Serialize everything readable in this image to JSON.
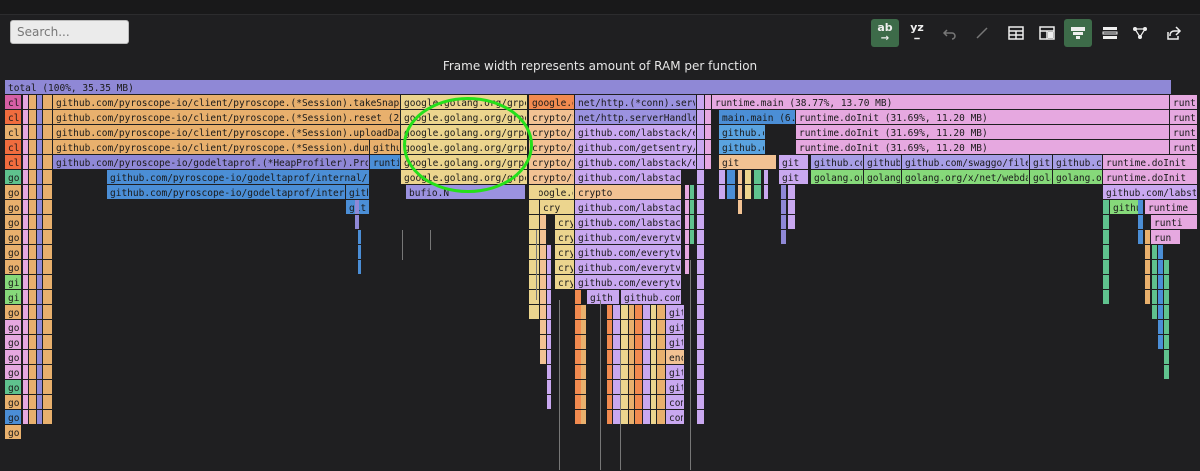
{
  "search": {
    "placeholder": "Search..."
  },
  "toolbar": {
    "abc_label": "ab",
    "xyz_label": "yz",
    "active_color": "#3d6b49"
  },
  "caption": "Frame width represents amount of RAM per function",
  "annotation": {
    "color": "#25e01a",
    "shape": "circle"
  },
  "flamegraph": {
    "rows": [
      [
        {
          "label": "total (100%, 35.35 MB)",
          "color": "#8f88d6"
        }
      ],
      [
        {
          "label": "clo",
          "color": "#d65fa5"
        },
        {
          "label": "github.com/pyroscope-io/client/pyroscope.(*Session).takeSnapshots (29.27",
          "color": "#e8b06d"
        },
        {
          "label": "google.golang.org/grpc.(*a",
          "color": "#ecd58e"
        },
        {
          "label": "google.go",
          "color": "#f18a4f"
        },
        {
          "label": "net/http.(*conn).serve (",
          "color": "#9b92e0"
        },
        {
          "label": "runtime.main (38.77%, 13.70 MB)",
          "color": "#e6a8e0"
        },
        {
          "label": "runt",
          "color": "#e6a8e0"
        }
      ],
      [
        {
          "label": "clo",
          "color": "#f06c3e"
        },
        {
          "label": "github.com/pyroscope-io/client/pyroscope.(*Session).reset (29.27%, 10.",
          "color": "#e8b06d"
        },
        {
          "label": "google.golang.org/grpc.(*a",
          "color": "#ecd58e"
        },
        {
          "label": "crypto/tl",
          "color": "#f2c293"
        },
        {
          "label": "net/http.serverHandler.S",
          "color": "#9b92e0"
        },
        {
          "label": "main.main (6.37",
          "color": "#4b8ed6"
        },
        {
          "label": "runtime.doInit (31.69%, 11.20 MB)",
          "color": "#e6a8e0"
        },
        {
          "label": "runt",
          "color": "#e6a8e0"
        }
      ],
      [
        {
          "label": "clo",
          "color": "#e8b06d"
        },
        {
          "label": "github.com/pyroscope-io/client/pyroscope.(*Session).uploadData (29.27%",
          "color": "#e8b06d"
        },
        {
          "label": "google.golang.org/grpc.(*a",
          "color": "#ecd58e"
        },
        {
          "label": "crypto/tl",
          "color": "#f2c293"
        },
        {
          "label": "github.com/labstack/echo",
          "color": "#c9a8f0"
        },
        {
          "label": "github.c",
          "color": "#5aa3e0"
        },
        {
          "label": "runtime.doInit (31.69%, 11.20 MB)",
          "color": "#e6a8e0"
        },
        {
          "label": "runt",
          "color": "#e6a8e0"
        }
      ],
      [
        {
          "label": "clo",
          "color": "#f06c3e"
        },
        {
          "label": "github.com/pyroscope-io/client/pyroscope.(*Session).dumpHeapProf",
          "color": "#e8b06d"
        },
        {
          "label": "githu",
          "color": "#e8b06d"
        },
        {
          "label": "google.golang.org/grpc/int",
          "color": "#ecd58e"
        },
        {
          "label": "crypto/tl",
          "color": "#f2c293"
        },
        {
          "label": "github.com/getsentry/sen",
          "color": "#c9a8f0"
        },
        {
          "label": "github.c",
          "color": "#5aa3e0"
        },
        {
          "label": "runtime.doInit (31.69%, 11.20 MB)",
          "color": "#e6a8e0"
        },
        {
          "label": "runt",
          "color": "#e6a8e0"
        }
      ],
      [
        {
          "label": "clo",
          "color": "#f06c3e"
        },
        {
          "label": "github.com/pyroscope-io/godeltaprof.(*HeapProfiler).Profile (26.",
          "color": "#8f88d6"
        },
        {
          "label": "runtim",
          "color": "#4b8ed6"
        },
        {
          "label": "google.golang.org/grpc/int",
          "color": "#ecd58e"
        },
        {
          "label": "crypto/tl",
          "color": "#f2c293"
        },
        {
          "label": "github.com/labstack/echo",
          "color": "#c9a8f0"
        },
        {
          "label": "git",
          "color": "#f2c293"
        },
        {
          "label": "git",
          "color": "#c9a8f0"
        },
        {
          "label": "github.com",
          "color": "#a79ee6"
        },
        {
          "label": "github.",
          "color": "#a79ee6"
        },
        {
          "label": "github.com/swaggo/files.in",
          "color": "#a79ee6"
        },
        {
          "label": "gith",
          "color": "#a79ee6"
        },
        {
          "label": "github.com",
          "color": "#a79ee6"
        },
        {
          "label": "runtime.doInit",
          "color": "#e6a8e0"
        }
      ],
      [
        {
          "label": "goo",
          "color": "#5fc28e"
        },
        {
          "label": "github.com/pyroscope-io/godeltaprof/internal/pprof.(*D",
          "color": "#4b8ed6"
        },
        {
          "label": "google.golang.org/grpc/in",
          "color": "#ecd58e"
        },
        {
          "label": "crypto/tl",
          "color": "#f2c293"
        },
        {
          "label": "github.com/labstack/e",
          "color": "#c9a8f0"
        },
        {
          "label": "git",
          "color": "#c9a8f0"
        },
        {
          "label": "golang.org",
          "color": "#86d97a"
        },
        {
          "label": "golang.",
          "color": "#86d97a"
        },
        {
          "label": "golang.org/x/net/webdav.(*",
          "color": "#86d97a"
        },
        {
          "label": "gola",
          "color": "#86d97a"
        },
        {
          "label": "golang.org",
          "color": "#86d97a"
        },
        {
          "label": "runtime.doInit",
          "color": "#e6a8e0"
        }
      ],
      [
        {
          "label": "goo",
          "color": "#e8b06d"
        },
        {
          "label": "github.com/pyroscope-io/godeltaprof/internal/pprof",
          "color": "#4b8ed6"
        },
        {
          "label": "githu",
          "color": "#4b8ed6"
        },
        {
          "label": "bufio.N",
          "color": "#9b92e0"
        },
        {
          "label": "google.golang.org",
          "color": "#ecd58e"
        },
        {
          "label": "crypto",
          "color": "#f2c293"
        },
        {
          "label": "github.com/labstack/e",
          "color": "#c9a8f0"
        },
        {
          "label": "runtime.doI",
          "color": "#e6a8e0"
        }
      ],
      [
        {
          "label": "goo",
          "color": "#e8b06d"
        },
        {
          "label": "git",
          "color": "#4b8ed6"
        },
        {
          "label": "cry",
          "color": "#ecd58e"
        },
        {
          "label": "github.com/labstack/e",
          "color": "#c9a8f0"
        },
        {
          "label": "githu",
          "color": "#86d97a"
        },
        {
          "label": "runtime",
          "color": "#e6a8e0"
        }
      ],
      [
        {
          "label": "goo",
          "color": "#e8b06d"
        },
        {
          "label": "cry",
          "color": "#ecd58e"
        },
        {
          "label": "github.com/labstack/e",
          "color": "#c9a8f0"
        },
        {
          "label": "runti",
          "color": "#e6a8e0"
        }
      ],
      [
        {
          "label": "goo",
          "color": "#e8b06d"
        },
        {
          "label": "cry",
          "color": "#ecd58e"
        },
        {
          "label": "github.com/everytv/ma",
          "color": "#c9a8f0"
        },
        {
          "label": "run",
          "color": "#e6a8e0"
        }
      ],
      [
        {
          "label": "goo",
          "color": "#e8b06d"
        },
        {
          "label": "cry",
          "color": "#ecd58e"
        },
        {
          "label": "github.com/everytv/ma",
          "color": "#c9a8f0"
        }
      ],
      [
        {
          "label": "goo",
          "color": "#e8b06d"
        },
        {
          "label": "cry",
          "color": "#ecd58e"
        },
        {
          "label": "github.com/everytv/ma",
          "color": "#c9a8f0"
        }
      ],
      [
        {
          "label": "git",
          "color": "#86d97a"
        },
        {
          "label": "cry",
          "color": "#ecd58e"
        },
        {
          "label": "github.com/everytv/ma",
          "color": "#c9a8f0"
        }
      ],
      [
        {
          "label": "git",
          "color": "#86d97a"
        },
        {
          "label": "gith",
          "color": "#c9a8f0"
        },
        {
          "label": "github.com/e",
          "color": "#c9a8f0"
        }
      ],
      [
        {
          "label": "goo",
          "color": "#e8b06d"
        },
        {
          "label": "git",
          "color": "#c9a8f0"
        }
      ],
      [
        {
          "label": "goo",
          "color": "#e6a8e0"
        },
        {
          "label": "git",
          "color": "#c9a8f0"
        }
      ],
      [
        {
          "label": "goo",
          "color": "#e6a8e0"
        },
        {
          "label": "git",
          "color": "#c9a8f0"
        }
      ],
      [
        {
          "label": "goo",
          "color": "#e6a8e0"
        },
        {
          "label": "enc",
          "color": "#f2c293"
        }
      ],
      [
        {
          "label": "goo",
          "color": "#e6a8e0"
        },
        {
          "label": "git",
          "color": "#c9a8f0"
        }
      ],
      [
        {
          "label": "goo",
          "color": "#5fc28e"
        },
        {
          "label": "git",
          "color": "#c9a8f0"
        }
      ],
      [
        {
          "label": "goo",
          "color": "#e8b06d"
        },
        {
          "label": "com",
          "color": "#c9a8f0"
        }
      ],
      [
        {
          "label": "goo",
          "color": "#4b8ed6"
        },
        {
          "label": "com",
          "color": "#c9a8f0"
        }
      ],
      [
        {
          "label": "goo",
          "color": "#e8b06d"
        }
      ]
    ]
  }
}
